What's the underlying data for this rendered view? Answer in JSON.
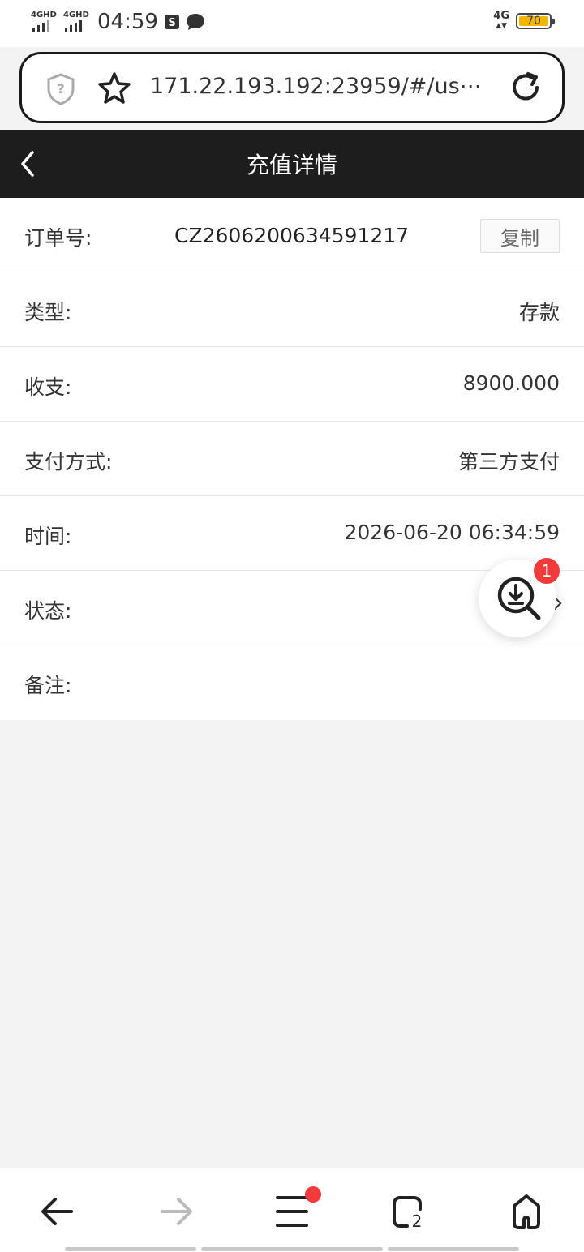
{
  "status_bar": {
    "signal1_label": "4GHD",
    "signal2_label": "4GHD",
    "time": "04:59",
    "network_label": "4G",
    "battery": "70",
    "battery_color": "#f2b500"
  },
  "browser": {
    "url": "171.22.193.192:23959/#/us⋯",
    "icons": [
      "shield-question-icon",
      "star-icon",
      "reload-icon"
    ]
  },
  "header": {
    "title": "充值详情",
    "bg_color": "#1d1d1d"
  },
  "detail": {
    "order_label": "订单号:",
    "order_value": "CZ2606200634591217",
    "copy_label": "复制",
    "type_label": "类型:",
    "type_value": "存款",
    "amount_label": "收支:",
    "amount_value": "8900.000",
    "pay_label": "支付方式:",
    "pay_value": "第三方支付",
    "time_label": "时间:",
    "time_value": "2026-06-20 06:34:59",
    "status_label": "状态:",
    "remark_label": "备注:"
  },
  "fab": {
    "badge": "1",
    "icon": "download-search-icon",
    "badge_color": "#f23a3a"
  },
  "bottom_nav": {
    "tab_count": "2",
    "icons": [
      "back-arrow-icon",
      "forward-arrow-icon",
      "menu-icon",
      "tabs-icon",
      "home-icon"
    ]
  }
}
